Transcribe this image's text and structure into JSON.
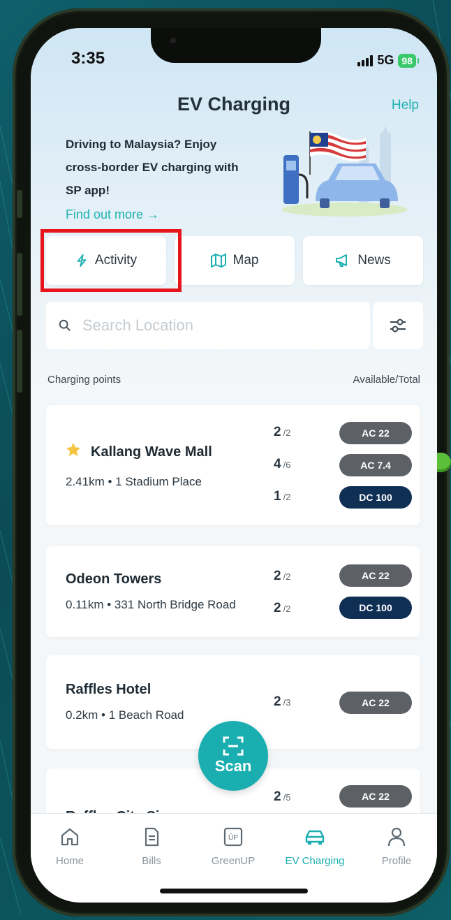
{
  "status_bar": {
    "time": "3:35",
    "network": "5G",
    "battery": "98"
  },
  "header": {
    "title": "EV Charging",
    "help": "Help"
  },
  "promo": {
    "text": "Driving to Malaysia? Enjoy cross-border EV charging with SP app!",
    "link": "Find out more →"
  },
  "quick_actions": [
    {
      "label": "Activity",
      "icon": "bolt-icon"
    },
    {
      "label": "Map",
      "icon": "map-icon"
    },
    {
      "label": "News",
      "icon": "megaphone-icon"
    }
  ],
  "search": {
    "placeholder": "Search Location"
  },
  "list_header": {
    "left": "Charging points",
    "right": "Available/Total"
  },
  "stations": [
    {
      "name": "Kallang Wave Mall",
      "favorite": true,
      "detail": "2.41km • 1 Stadium Place",
      "chargers": [
        {
          "available": "2",
          "total": "/2",
          "type": "AC 22"
        },
        {
          "available": "4",
          "total": "/6",
          "type": "AC 7.4"
        },
        {
          "available": "1",
          "total": "/2",
          "type": "DC 100"
        }
      ]
    },
    {
      "name": "Odeon Towers",
      "favorite": false,
      "detail": "0.11km • 331 North Bridge Road",
      "chargers": [
        {
          "available": "2",
          "total": "/2",
          "type": "AC 22"
        },
        {
          "available": "2",
          "total": "/2",
          "type": "DC 100"
        }
      ]
    },
    {
      "name": "Raffles Hotel",
      "favorite": false,
      "detail": "0.2km • 1 Beach Road",
      "chargers": [
        {
          "available": "2",
          "total": "/3",
          "type": "AC 22"
        }
      ]
    },
    {
      "name": "Raffles City Singapore",
      "favorite": false,
      "detail": "",
      "chargers": [
        {
          "available": "2",
          "total": "/5",
          "type": "AC 22"
        }
      ]
    }
  ],
  "scan": {
    "label": "Scan"
  },
  "tabs": [
    {
      "label": "Home",
      "icon": "home-icon"
    },
    {
      "label": "Bills",
      "icon": "bills-icon"
    },
    {
      "label": "GreenUP",
      "icon": "greenup-icon"
    },
    {
      "label": "EV Charging",
      "icon": "car-icon",
      "active": true
    },
    {
      "label": "Profile",
      "icon": "profile-icon"
    }
  ],
  "colors": {
    "accent": "#1aaeb0",
    "highlight": "#e6141b",
    "dc_pill": "#0f2f55",
    "ac_pill": "#5d6166"
  }
}
